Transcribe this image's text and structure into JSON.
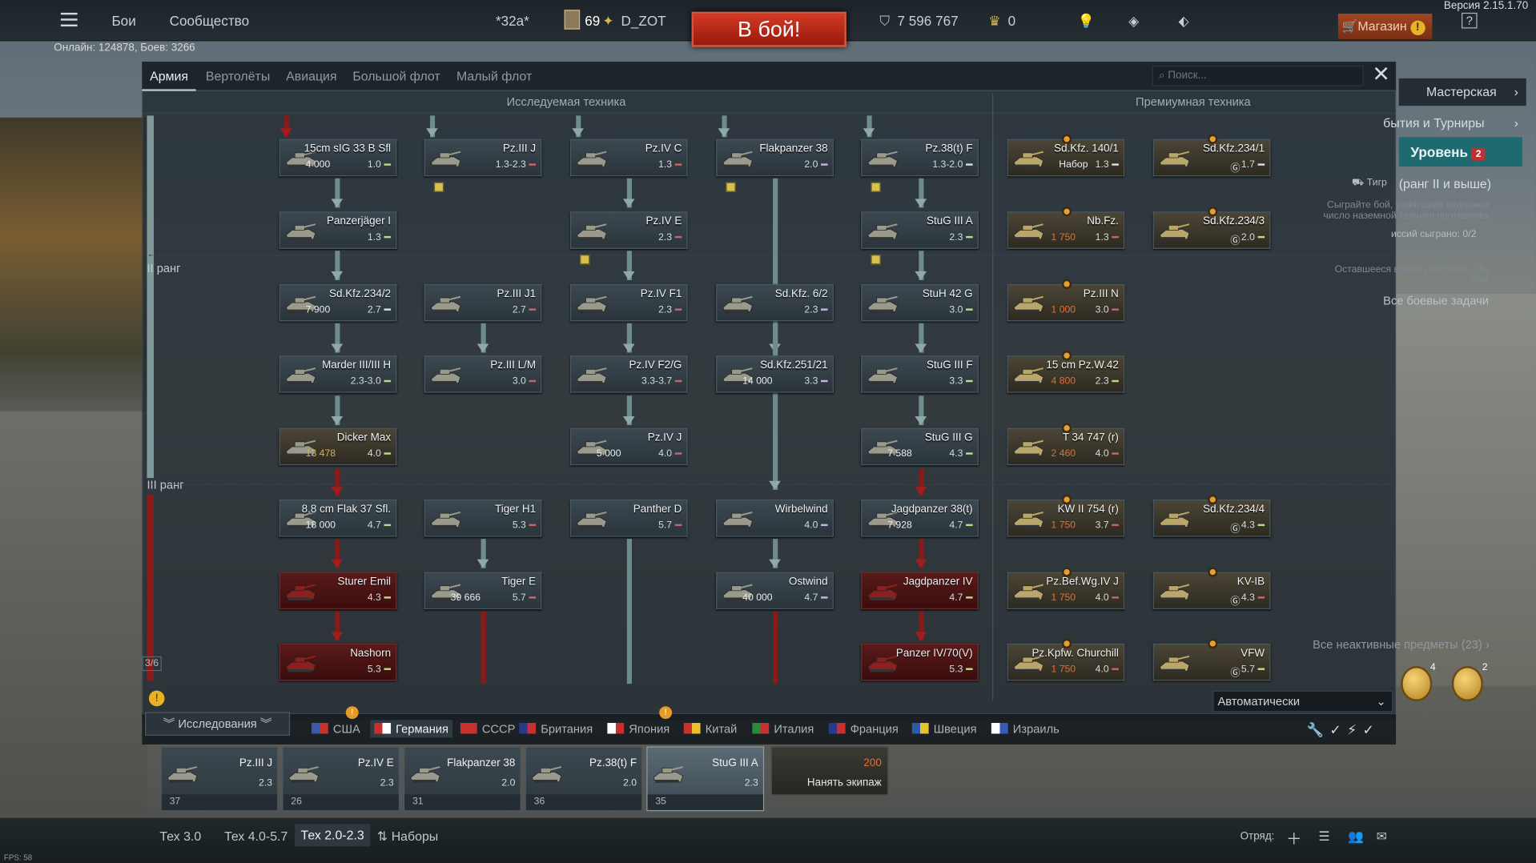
{
  "topbar": {
    "battles": "Бои",
    "community": "Сообщество",
    "squad_tag": "*32a*",
    "level": "69",
    "nickname": "D_ZOT",
    "fight": "В бой!",
    "silver": "7 596 767",
    "gold": "0",
    "shop": "Магазин",
    "version": "Версия 2.15.1.70",
    "help": "?"
  },
  "online": "Онлайн: 124878, Боев: 3266",
  "tabs": [
    "Армия",
    "Вертолёты",
    "Авиация",
    "Большой флот",
    "Малый флот"
  ],
  "search_placeholder": "Поиск...",
  "section_research": "Исследуемая техника",
  "section_premium": "Премиумная техника",
  "ranks": {
    "r2": "II ранг",
    "r3": "III ранг",
    "page": "3/6"
  },
  "tree": [
    {
      "name": "15cm sIG 33 B Sfl",
      "rp": "4 000",
      "br": "1.0",
      "type": "s"
    },
    {
      "name": "Pz.III J",
      "br": "1.3-2.3",
      "type": "l"
    },
    {
      "name": "Pz.IV C",
      "br": "1.3",
      "type": "l"
    },
    {
      "name": "Flakpanzer 38",
      "br": "2.0",
      "type": "a"
    },
    {
      "name": "Pz.38(t) F",
      "br": "1.3-2.0",
      "type": "t"
    },
    {
      "name": "Panzerjäger I",
      "br": "1.3",
      "type": "s"
    },
    {
      "name": "Pz.IV E",
      "br": "2.3",
      "type": "l"
    },
    {
      "name": "StuG III A",
      "br": "2.3",
      "type": "s"
    },
    {
      "name": "Sd.Kfz.234/2",
      "rp": "7 900",
      "br": "2.7",
      "type": "t"
    },
    {
      "name": "Pz.III J1",
      "br": "2.7",
      "type": "l"
    },
    {
      "name": "Pz.IV F1",
      "br": "2.3",
      "type": "l"
    },
    {
      "name": "Sd.Kfz. 6/2",
      "br": "2.3",
      "type": "a"
    },
    {
      "name": "StuH 42 G",
      "br": "3.0",
      "type": "s"
    },
    {
      "name": "Marder III/III H",
      "br": "2.3-3.0",
      "type": "s"
    },
    {
      "name": "Pz.III L/M",
      "br": "3.0",
      "type": "l"
    },
    {
      "name": "Pz.IV F2/G",
      "br": "3.3-3.7",
      "type": "l"
    },
    {
      "name": "Sd.Kfz.251/21",
      "rp": "14 000",
      "br": "3.3",
      "type": "a"
    },
    {
      "name": "StuG III F",
      "br": "3.3",
      "type": "s"
    },
    {
      "name": "Dicker Max",
      "rp": "13 478",
      "br": "4.0",
      "type": "s"
    },
    {
      "name": "Pz.IV J",
      "rp": "5 000",
      "br": "4.0",
      "type": "l"
    },
    {
      "name": "StuG III G",
      "rp": "7 588",
      "br": "4.3",
      "type": "s"
    },
    {
      "name": "8,8 cm Flak 37 Sfl.",
      "rp": "18 000",
      "br": "4.7",
      "type": "s"
    },
    {
      "name": "Tiger H1",
      "br": "5.3",
      "type": "l"
    },
    {
      "name": "Panther D",
      "br": "5.7",
      "type": "l"
    },
    {
      "name": "Wirbelwind",
      "br": "4.0",
      "type": "a"
    },
    {
      "name": "Jagdpanzer 38(t)",
      "rp": "7 928",
      "br": "4.7",
      "type": "s"
    },
    {
      "name": "Sturer Emil",
      "br": "4.3",
      "type": "s"
    },
    {
      "name": "Tiger E",
      "rp": "39 666",
      "br": "5.7",
      "type": "l"
    },
    {
      "name": "Ostwind",
      "rp": "40 000",
      "br": "4.7",
      "type": "a"
    },
    {
      "name": "Jagdpanzer IV",
      "br": "4.7",
      "type": "s"
    },
    {
      "name": "Nashorn",
      "br": "5.3",
      "type": "s"
    },
    {
      "name": "Panzer IV/70(V)",
      "br": "5.3",
      "type": "s"
    }
  ],
  "premium": [
    {
      "name": "Sd.Kfz. 140/1",
      "price": "Набор",
      "br": "1.3",
      "type": "t"
    },
    {
      "name": "Sd.Kfz.234/1",
      "price": "",
      "br": "1.7",
      "type": "t"
    },
    {
      "name": "Nb.Fz.",
      "price": "1 750",
      "br": "1.3",
      "type": "l"
    },
    {
      "name": "Sd.Kfz.234/3",
      "price": "",
      "br": "2.0",
      "type": "s"
    },
    {
      "name": "Pz.III N",
      "price": "1 000",
      "br": "3.0",
      "type": "l"
    },
    {
      "name": "15 cm Pz.W.42",
      "price": "4 800",
      "br": "2.3",
      "type": "s"
    },
    {
      "name": "T 34 747 (r)",
      "price": "2 460",
      "br": "4.0",
      "type": "l"
    },
    {
      "name": "KW II 754 (r)",
      "price": "1 750",
      "br": "3.7",
      "type": "h"
    },
    {
      "name": "Sd.Kfz.234/4",
      "price": "",
      "br": "4.3",
      "type": "s"
    },
    {
      "name": "Pz.Bef.Wg.IV J",
      "price": "1 750",
      "br": "4.0",
      "type": "l"
    },
    {
      "name": "KV-IB",
      "price": "",
      "br": "4.3",
      "type": "h"
    },
    {
      "name": "Pz.Kpfw. Churchill",
      "price": "1 750",
      "br": "4.0",
      "type": "h"
    },
    {
      "name": "VFW",
      "price": "",
      "br": "5.7",
      "type": "s"
    }
  ],
  "right": {
    "workshop": "Мастерская",
    "events": "бытия и Турниры",
    "level": "Уровень",
    "tiger": "Тигр",
    "rank_note": "(ранг II и выше)",
    "task": "Сыграйте бой, уничтожив заданное число наземной техники противника",
    "progress": "иссий сыграно: 0/2",
    "remaining": "Оставшееся время действия: 21ч. 58м.",
    "all_tasks": "Все боевые задачи",
    "inactive": "Все неактивные предметы (23)",
    "m1": "4",
    "m2": "2",
    "auto": "Автоматически"
  },
  "nations": [
    "США",
    "Германия",
    "СССР",
    "Британия",
    "Япония",
    "Китай",
    "Италия",
    "Франция",
    "Швеция",
    "Израиль"
  ],
  "research_btn": "Исследования",
  "crew": [
    {
      "name": "Pz.III J",
      "br": "2.3",
      "crew": "37"
    },
    {
      "name": "Pz.IV E",
      "br": "2.3",
      "crew": "26"
    },
    {
      "name": "Flakpanzer 38",
      "br": "2.0",
      "crew": "31"
    },
    {
      "name": "Pz.38(t) F",
      "br": "2.0",
      "crew": "36"
    },
    {
      "name": "StuG III A",
      "br": "2.3",
      "crew": "35"
    }
  ],
  "hire": {
    "price": "200",
    "label": "Нанять экипаж"
  },
  "presets": [
    "Тех 3.0",
    "Тех 4.0-5.7",
    "Тех 2.0-2.3",
    "Наборы"
  ],
  "squad_label": "Отряд:",
  "fps": "FPS: 58"
}
